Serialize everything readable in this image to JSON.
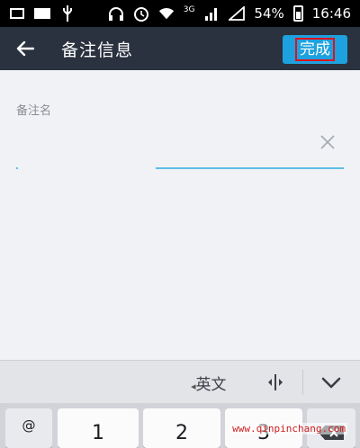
{
  "status_bar": {
    "network_type": "3G",
    "battery_percent": "54%",
    "time": "16:46",
    "icons": [
      "notification-box-icon",
      "image-icon",
      "usb-icon",
      "headphones-icon",
      "alarm-icon",
      "wifi-icon",
      "signal-icon",
      "no-sim-icon",
      "battery-icon"
    ]
  },
  "header": {
    "title": "备注信息",
    "done_label": "完成",
    "back_icon": "back-arrow-icon"
  },
  "form": {
    "field_label": "备注名",
    "field_value": "",
    "clear_icon": "clear-x-icon"
  },
  "keyboard": {
    "language_label": "英文",
    "language_arrow": "◂",
    "keys": [
      "@",
      "1",
      "2",
      "3"
    ],
    "icons": [
      "cursor-move-icon",
      "hide-keyboard-icon",
      "delete-icon"
    ]
  },
  "watermark": "www.qinpinchang.com",
  "colors": {
    "title_bar": "#2a3240",
    "accent": "#1ea1df",
    "highlight_border": "#e0121b"
  }
}
